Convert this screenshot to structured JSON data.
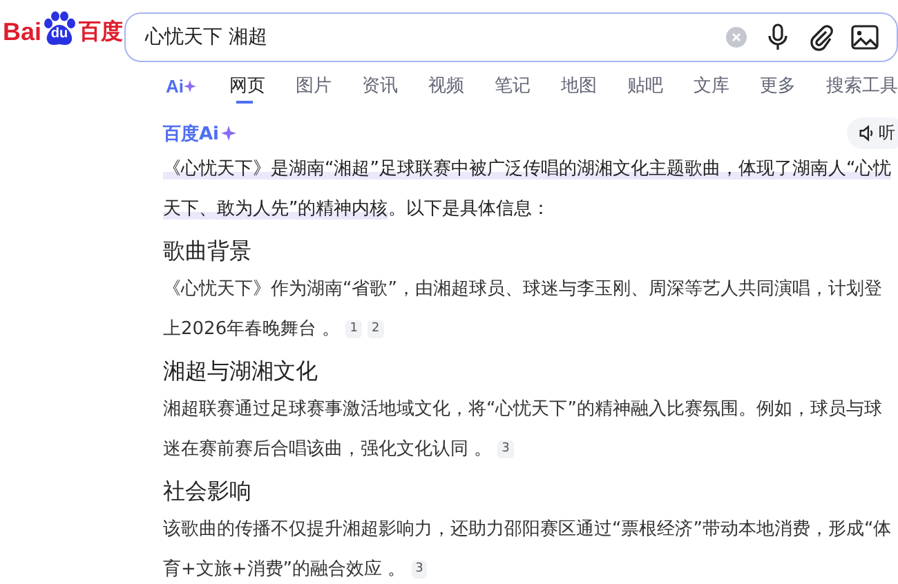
{
  "logo": {
    "left": "Bai",
    "paw": "du",
    "right": "百度"
  },
  "search": {
    "value": "心忧天下 湘超"
  },
  "tabs": [
    {
      "label": "Ai",
      "kind": "ai",
      "selected": false
    },
    {
      "label": "网页",
      "kind": "text",
      "selected": true
    },
    {
      "label": "图片",
      "kind": "text",
      "selected": false
    },
    {
      "label": "资讯",
      "kind": "text",
      "selected": false
    },
    {
      "label": "视频",
      "kind": "text",
      "selected": false
    },
    {
      "label": "笔记",
      "kind": "text",
      "selected": false
    },
    {
      "label": "地图",
      "kind": "text",
      "selected": false
    },
    {
      "label": "贴吧",
      "kind": "text",
      "selected": false
    },
    {
      "label": "文库",
      "kind": "text",
      "selected": false
    },
    {
      "label": "更多",
      "kind": "text",
      "selected": false
    },
    {
      "label": "搜索工具",
      "kind": "text",
      "selected": false
    }
  ],
  "answer": {
    "brand": "百度Ai",
    "listen": "听",
    "intro": {
      "highlight": "《心忧天下》是湖南“湘超”足球联赛中被广泛传唱的湖湘文化主题歌曲，体现了湖南人“心忧天下、敢为人先”的精神内核",
      "rest": "。以下是具体信息："
    },
    "sections": [
      {
        "heading": "歌曲背景",
        "text": "《心忧天下》作为湖南“省歌”，由湘超球员、球迷与李玉刚、周深等艺人共同演唱，计划登上2026年春晚舞台 。",
        "citations": [
          "1",
          "2"
        ]
      },
      {
        "heading": "湘超与湖湘文化",
        "text": "湘超联赛通过足球赛事激活地域文化，将“心忧天下”的精神融入比赛氛围。例如，球员与球迷在赛前赛后合唱该曲，强化文化认同 。",
        "citations": [
          "3"
        ]
      },
      {
        "heading": "社会影响",
        "text": "该歌曲的传播不仅提升湘超影响力，还助力邵阳赛区通过“票根经济”带动本地消费，形成“体育+文旅+消费”的融合效应 。",
        "citations": [
          "3"
        ]
      }
    ]
  }
}
